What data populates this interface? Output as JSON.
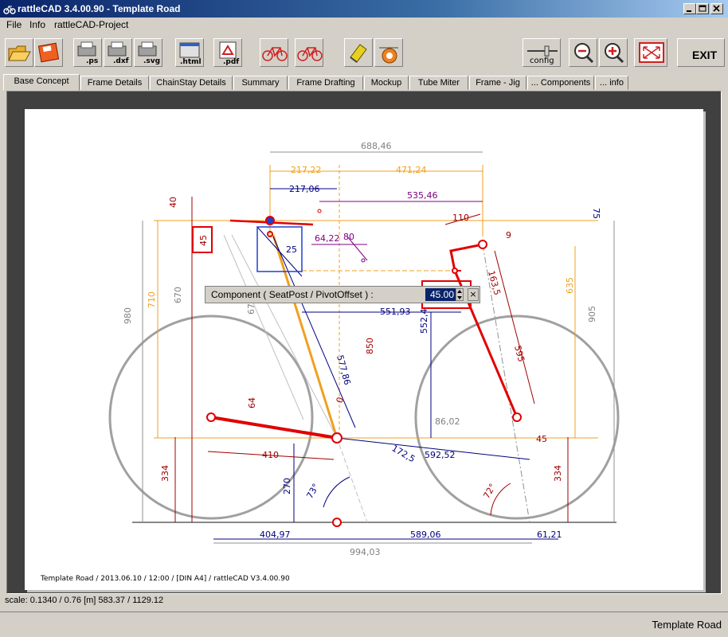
{
  "window": {
    "title": "rattleCAD  3.4.00.90 - Template Road"
  },
  "menu": {
    "items": [
      "File",
      "Info",
      "rattleCAD-Project"
    ]
  },
  "toolbar": {
    "ps": ".ps",
    "dxf": ".dxf",
    "svg": ".svg",
    "html": ".html",
    "pdf": ".pdf",
    "config": "config",
    "exit": "EXIT"
  },
  "tabs": [
    "Base Concept",
    "Frame Details",
    "ChainStay Details",
    "Summary",
    "Frame Drafting",
    "Mockup",
    "Tube Miter",
    "Frame - Jig",
    "... Components",
    "... info"
  ],
  "active_tab": "Base Concept",
  "dialog": {
    "label": "Component ( SeatPost / PivotOffset ) :",
    "value": "45.00",
    "close": "×"
  },
  "drawing": {
    "dims": {
      "d688": "688,46",
      "d217a": "217,22",
      "d471": "471,24",
      "d217b": "217,06",
      "d535": "535,46",
      "d75": "75",
      "d40": "40",
      "d110": "110",
      "d9": "9",
      "d45box": "45",
      "d25": "25",
      "d64_22": "64,22",
      "d80": "80",
      "d710": "710",
      "d670": "670",
      "d980": "980",
      "d551": "551,93",
      "d552": "552,4",
      "d635": "635",
      "d905": "905",
      "d463": "163,5",
      "d595": "595",
      "d850": "850",
      "d577": "577,86",
      "d64": "64",
      "d0": "0",
      "d86": "86,02",
      "d45b": "45",
      "d410": "410",
      "d172": "172,5",
      "d592": "592,52",
      "d334a": "334",
      "d270": "270",
      "d73": "73°",
      "d72": "72°",
      "d334b": "334",
      "d404": "404,97",
      "d589": "589,06",
      "d61": "61,21",
      "d994": "994,03",
      "d6": "67"
    },
    "footer": "Template Road   /   2013.06.10 / 12:00   /  [DIN  A4]  /   rattleCAD   V3.4.00.90"
  },
  "status": {
    "scale": "scale: 0.1340 / 0.76  [m]  583.37 / 1129.12"
  },
  "bottom": {
    "project": "Template Road"
  }
}
